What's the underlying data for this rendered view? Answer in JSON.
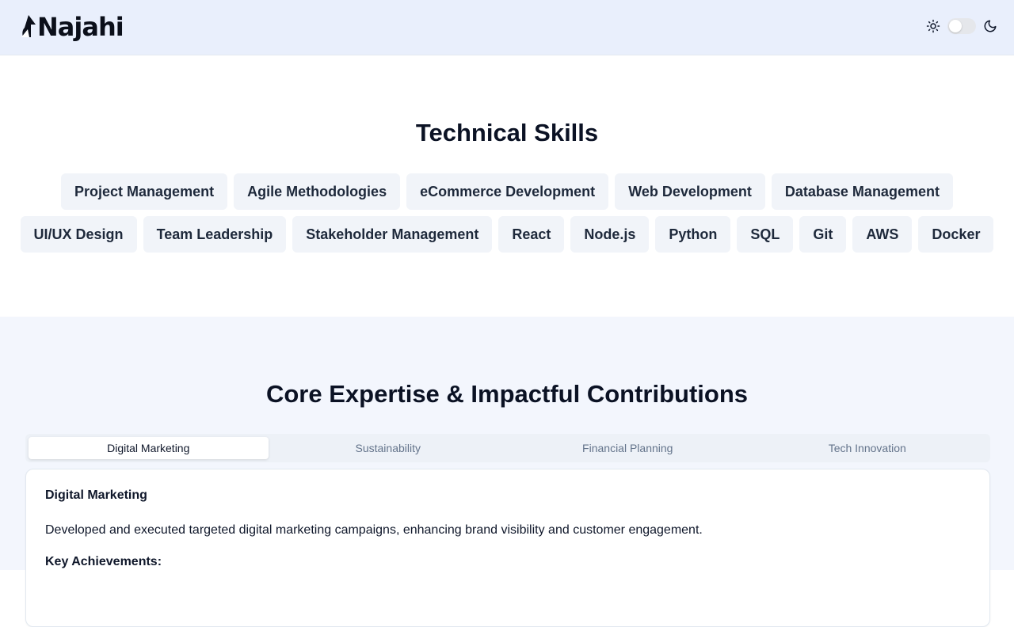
{
  "header": {
    "logo_text": "Najahi",
    "icons": {
      "light": "sun-icon",
      "dark": "moon-icon"
    },
    "theme_toggle": {
      "state": "off"
    }
  },
  "skills": {
    "title": "Technical Skills",
    "row1": [
      "Project Management",
      "Agile Methodologies",
      "eCommerce Development",
      "Web Development",
      "Database Management"
    ],
    "row2": [
      "UI/UX Design",
      "Team Leadership",
      "Stakeholder Management",
      "React",
      "Node.js",
      "Python",
      "SQL",
      "Git",
      "AWS",
      "Docker"
    ]
  },
  "expertise": {
    "title": "Core Expertise & Impactful Contributions",
    "tabs": [
      "Digital Marketing",
      "Sustainability",
      "Financial Planning",
      "Tech Innovation"
    ],
    "active_tab": "Digital Marketing",
    "panel": {
      "title": "Digital Marketing",
      "description": "Developed and executed targeted digital marketing campaigns, enhancing brand visibility and customer engagement.",
      "subheading": "Key Achievements:"
    }
  },
  "colors": {
    "header_bg": "#e9effc",
    "section_alt_bg": "#f3f6fd",
    "chip_bg": "#f1f4f9",
    "text_dark": "#0f172a",
    "text_muted": "#64748b"
  }
}
